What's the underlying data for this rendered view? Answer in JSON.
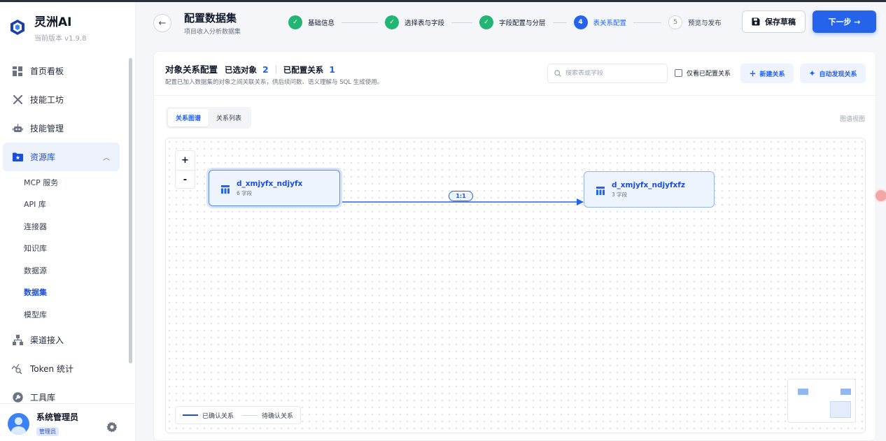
{
  "app": {
    "name": "灵洲AI",
    "version": "当前版本 v1.9.8",
    "brand_color": "#2563eb"
  },
  "sidebar": {
    "items": [
      {
        "label": "首页看板",
        "icon": "dashboard-icon"
      },
      {
        "label": "技能工坊",
        "icon": "tools-icon"
      },
      {
        "label": "技能管理",
        "icon": "robot-icon"
      },
      {
        "label": "资源库",
        "icon": "folder-star-icon",
        "expanded": true
      },
      {
        "label": "渠道接入",
        "icon": "network-icon"
      },
      {
        "label": "Token 统计",
        "icon": "chart-search-icon"
      },
      {
        "label": "工具库",
        "icon": "wrench-icon"
      }
    ],
    "resource_sub": [
      "MCP 服务",
      "API 库",
      "连接器",
      "知识库",
      "数据源",
      "数据集",
      "模型库"
    ],
    "active_sub": "数据集"
  },
  "user": {
    "name": "系统管理员",
    "role": "管理员"
  },
  "header": {
    "title": "配置数据集",
    "subtitle": "项目收入分析数据集",
    "steps": [
      {
        "num": "1",
        "label": "基础信息",
        "state": "done"
      },
      {
        "num": "2",
        "label": "选择表与字段",
        "state": "done"
      },
      {
        "num": "3",
        "label": "字段配置与分层",
        "state": "done"
      },
      {
        "num": "4",
        "label": "表关系配置",
        "state": "current"
      },
      {
        "num": "5",
        "label": "预览与发布",
        "state": "todo"
      }
    ],
    "save_label": "保存草稿",
    "next_label": "下一步 →"
  },
  "panel": {
    "title": "对象关系配置",
    "selected_label": "已选对象",
    "selected_count": "2",
    "configured_label": "已配置关系",
    "configured_count": "1",
    "description": "配置已加入数据集的对象之间关联关系，供后续问数、语义理解与 SQL 生成使用。",
    "search_placeholder": "搜索表或字段",
    "only_configured_label": "仅看已配置关系",
    "only_configured_checked": false,
    "new_relation_label": "新建关系",
    "auto_discover_label": "自动发现关系",
    "tabs": [
      "关系图谱",
      "关系列表"
    ],
    "active_tab": "关系图谱",
    "view_label": "图谱视图"
  },
  "graph": {
    "nodes": [
      {
        "name": "d_xmjyfx_ndjyfx",
        "meta": "6 字段",
        "selected": true
      },
      {
        "name": "d_xmjyfx_ndjyfxfz",
        "meta": "3 字段",
        "selected": false
      }
    ],
    "edges": [
      {
        "from": "d_xmjyfx_ndjyfx",
        "to": "d_xmjyfx_ndjyfxfz",
        "cardinality": "1:1",
        "status": "confirmed"
      }
    ],
    "zoom_in": "+",
    "zoom_out": "-",
    "legend": {
      "confirmed": "已确认关系",
      "pending": "待确认关系"
    }
  }
}
